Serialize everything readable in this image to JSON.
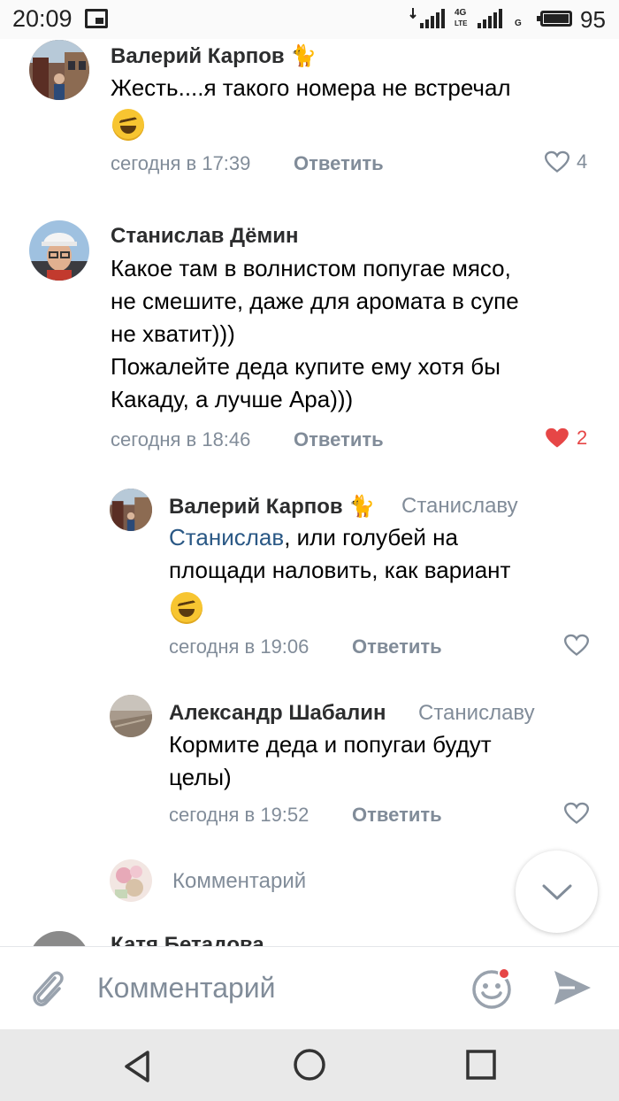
{
  "status_bar": {
    "time": "20:09",
    "network1": "4G",
    "network1_sub": "LTE",
    "network2": "G",
    "battery": "95"
  },
  "comments": [
    {
      "author": "Валерий Карпов 🐈",
      "text_lines": [
        "Жесть....я такого номера не встречал"
      ],
      "emoji": "rofl-emoji",
      "time": "сегодня в 17:39",
      "reply_label": "Ответить",
      "likes": "4",
      "liked": false
    },
    {
      "author": "Станислав Дёмин",
      "text_lines": [
        "Какое там в волнистом попугае мясо,",
        "не смешите, даже для аромата в супе",
        "не хватит)))",
        "Пожалейте деда купите ему хотя бы",
        "Какаду, а лучше Ара)))"
      ],
      "time": "сегодня в 18:46",
      "reply_label": "Ответить",
      "likes": "2",
      "liked": true
    },
    {
      "author": "Валерий Карпов 🐈",
      "reply_to": "Станиславу",
      "mention": "Станислав",
      "text_line1_rest": ", или голубей на",
      "text_line2": "площади наловить, как вариант",
      "emoji": "rofl-emoji",
      "time": "сегодня в 19:06",
      "reply_label": "Ответить"
    },
    {
      "author": "Александр Шабалин",
      "reply_to": "Станиславу",
      "text_lines": [
        "Кормите деда и попугаи будут",
        "целы)"
      ],
      "time": "сегодня в 19:52",
      "reply_label": "Ответить"
    }
  ],
  "add_comment_placeholder": "Комментарий",
  "next_author_cut": "Катя Бетадова",
  "input": {
    "placeholder": "Комментарий"
  },
  "colors": {
    "link": "#2a5885",
    "muted": "#818c99",
    "like_red": "#e64646",
    "accent_blue": "#5181b8"
  }
}
